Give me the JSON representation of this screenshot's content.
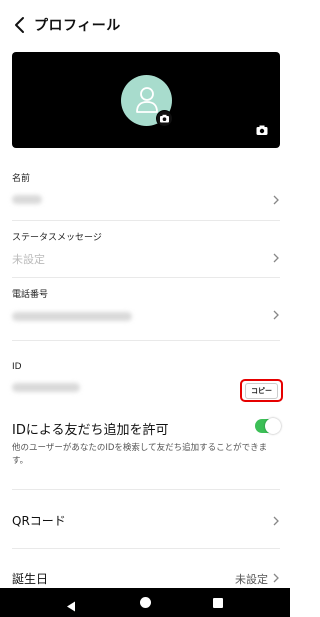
{
  "header": {
    "title": "プロフィール",
    "back_icon": "chevron-left-icon"
  },
  "profile": {
    "avatar_icon": "person-outline-icon",
    "avatar_bg": "#a8dccd",
    "cover_bg": "#000000",
    "camera_icon": "camera-icon"
  },
  "fields": {
    "name": {
      "label": "名前"
    },
    "status": {
      "label": "ステータスメッセージ",
      "value": "未設定"
    },
    "phone": {
      "label": "電話番号"
    },
    "id": {
      "label": "ID",
      "copy_label": "コピー"
    }
  },
  "allow_add": {
    "title": "IDによる友だち追加を許可",
    "description": "他のユーザーがあなたのIDを検索して友だち追加することができます。",
    "enabled": true,
    "toggle_color": "#3cbf57"
  },
  "qr": {
    "label": "QRコード"
  },
  "birthday": {
    "label": "誕生日",
    "value": "未設定"
  },
  "highlight_color": "#e60000",
  "navbar": {
    "back_icon": "nav-back-icon",
    "home_icon": "nav-home-icon",
    "recent_icon": "nav-recent-icon"
  }
}
